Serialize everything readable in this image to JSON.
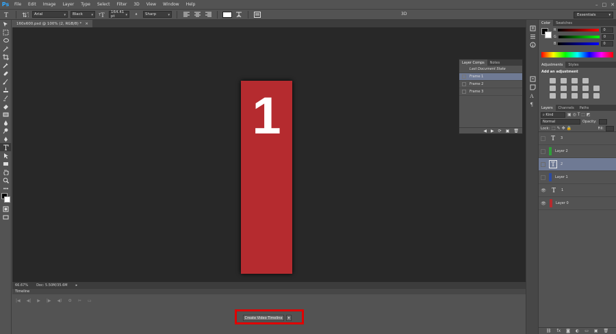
{
  "app": {
    "logo": "Ps"
  },
  "menu": [
    "File",
    "Edit",
    "Image",
    "Layer",
    "Type",
    "Select",
    "Filter",
    "3D",
    "View",
    "Window",
    "Help"
  ],
  "options": {
    "font_family": "Arial",
    "font_style": "Black",
    "font_size": "164.41 pt",
    "aa_label": "a",
    "antialias": "Sharp",
    "three_d": "3D",
    "workspace": "Essentials",
    "text_color": "#ffffff"
  },
  "document": {
    "tab_title": "160x600.psd @ 100% (2, RGB/8) *",
    "artboard_text": "1",
    "artboard_color": "#b52b2f",
    "zoom": "66.67%",
    "doc_info": "Doc: 5.50M/35.6M"
  },
  "timeline": {
    "title": "Timeline",
    "create_button": "Create Video Timeline",
    "highlight_color": "#e00000"
  },
  "layer_comps": {
    "tabs": [
      "Layer Comps",
      "Notes"
    ],
    "items": [
      {
        "label": "Last Document State",
        "selected": false
      },
      {
        "label": "Frame 1",
        "selected": true
      },
      {
        "label": "Frame 2",
        "selected": false
      },
      {
        "label": "Frame 3",
        "selected": false
      }
    ]
  },
  "color_panel": {
    "tabs": [
      "Color",
      "Swatches"
    ],
    "rows": [
      {
        "label": "R",
        "value": "0"
      },
      {
        "label": "G",
        "value": "0"
      },
      {
        "label": "B",
        "value": "0"
      }
    ]
  },
  "adjustments": {
    "tabs": [
      "Adjustments",
      "Styles"
    ],
    "title": "Add an adjustment"
  },
  "layers_panel": {
    "tabs": [
      "Layers",
      "Channels",
      "Paths"
    ],
    "kind": "Kind",
    "blend": "Normal",
    "opacity_label": "Opacity:",
    "lock_label": "Lock:",
    "fill_label": "Fill:",
    "layers": [
      {
        "name": "3",
        "type": "text",
        "visible": false,
        "selected": false,
        "color": ""
      },
      {
        "name": "Layer 2",
        "type": "fill",
        "visible": false,
        "selected": false,
        "color": "#2fa03a"
      },
      {
        "name": "2",
        "type": "text",
        "visible": false,
        "selected": true,
        "color": ""
      },
      {
        "name": "Layer 1",
        "type": "fill",
        "visible": false,
        "selected": false,
        "color": "#2c4aa0"
      },
      {
        "name": "1",
        "type": "text",
        "visible": true,
        "selected": false,
        "color": ""
      },
      {
        "name": "Layer 0",
        "type": "fill",
        "visible": true,
        "selected": false,
        "color": "#b52b2f"
      }
    ]
  }
}
